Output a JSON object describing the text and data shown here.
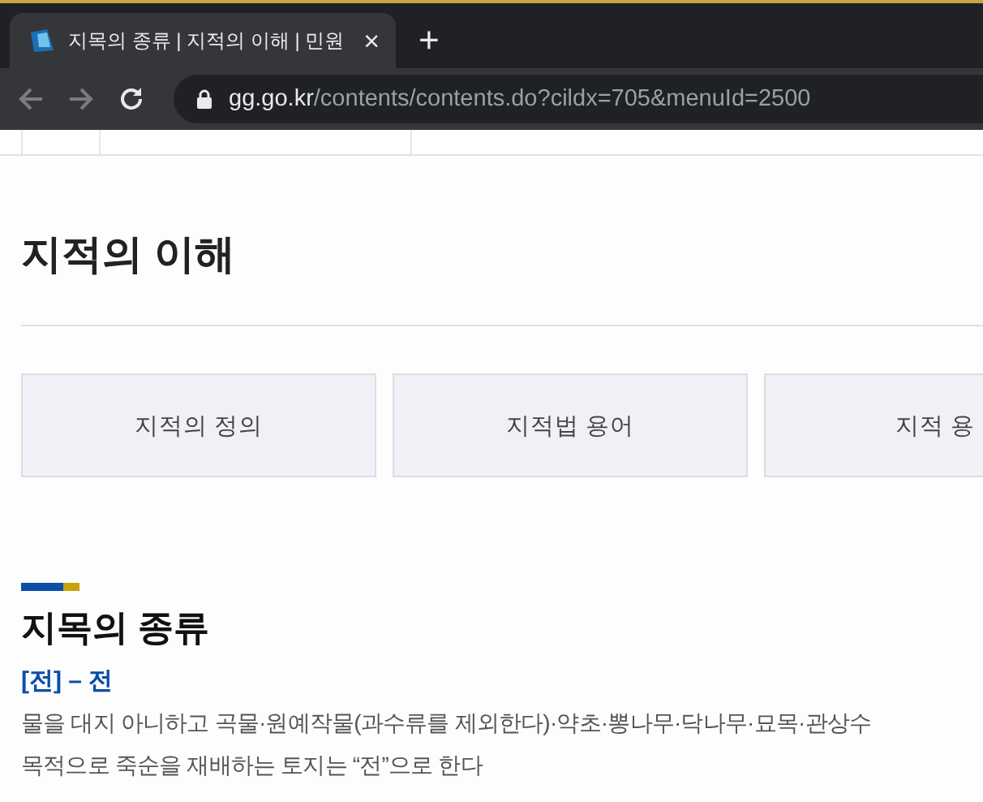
{
  "browser": {
    "tab": {
      "title": "지목의 종류 | 지적의 이해 | 민원",
      "close": "×"
    },
    "new_tab": "+",
    "url": {
      "host": "gg.go.kr",
      "path": "/contents/contents.do?cildx=705&menuId=2500"
    }
  },
  "page": {
    "title": "지적의 이해",
    "menu": [
      {
        "label": "지적의 정의",
        "selected": false
      },
      {
        "label": "지적법 용어",
        "selected": false
      },
      {
        "label": "지적 용",
        "selected": false
      }
    ],
    "section": {
      "title": "지목의 종류",
      "term": "[전] – 전",
      "paragraph": [
        "물을 대지 아니하고 곡물·원예작물(과수류를 제외한다)·약초·뽕나무·닥나무·묘목·관상수",
        "목적으로 죽순을 재배하는 토지는 “전”으로 한다"
      ]
    }
  }
}
